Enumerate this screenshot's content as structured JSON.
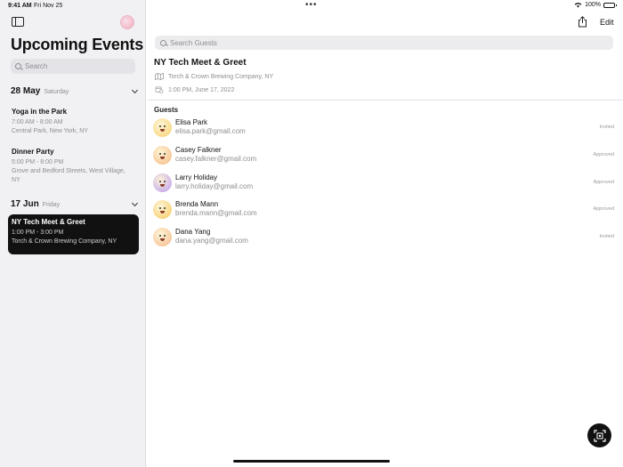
{
  "status_bar": {
    "time": "9:41 AM",
    "date": "Fri Nov 25",
    "battery": "100%",
    "battery_level": 1.0
  },
  "sidebar": {
    "title": "Upcoming Events",
    "search_placeholder": "Search",
    "days": [
      {
        "date": "28 May",
        "weekday": "Saturday",
        "events": [
          {
            "title": "Yoga in the Park",
            "time": "7:00 AM - 8:00 AM",
            "location": "Central Park, New York, NY",
            "selected": false
          },
          {
            "title": "Dinner Party",
            "time": "5:00 PM - 8:00 PM",
            "location": "Grove and Bedford Streets, West Village, NY",
            "selected": false
          }
        ]
      },
      {
        "date": "17 Jun",
        "weekday": "Friday",
        "events": [
          {
            "title": "NY Tech Meet & Greet",
            "time": "1:00 PM - 3:00 PM",
            "location": "Torch & Crown Brewing Company, NY",
            "selected": true
          }
        ]
      }
    ]
  },
  "toolbar": {
    "edit_label": "Edit"
  },
  "main": {
    "search_placeholder": "Search Guests",
    "event_title": "NY Tech Meet & Greet",
    "location": "Torch & Crown Brewing Company, NY",
    "datetime": "1:00 PM, June 17, 2022",
    "guests_heading": "Guests",
    "guests": [
      {
        "name": "Elisa Park",
        "email": "elisa.park@gmail.com",
        "status": "Invited",
        "avatar_color": "#f6cf6a"
      },
      {
        "name": "Casey Falkner",
        "email": "casey.falkner@gmail.com",
        "status": "Approved",
        "avatar_color": "#f4b77e"
      },
      {
        "name": "Larry Holiday",
        "email": "larry.holiday@gmail.com",
        "status": "Approved",
        "avatar_color": "#b996f2"
      },
      {
        "name": "Brenda Mann",
        "email": "brenda.mann@gmail.com",
        "status": "Approved",
        "avatar_color": "#f6c65c"
      },
      {
        "name": "Dana Yang",
        "email": "dana.yang@gmail.com",
        "status": "Invited",
        "avatar_color": "#f3b888"
      }
    ]
  }
}
